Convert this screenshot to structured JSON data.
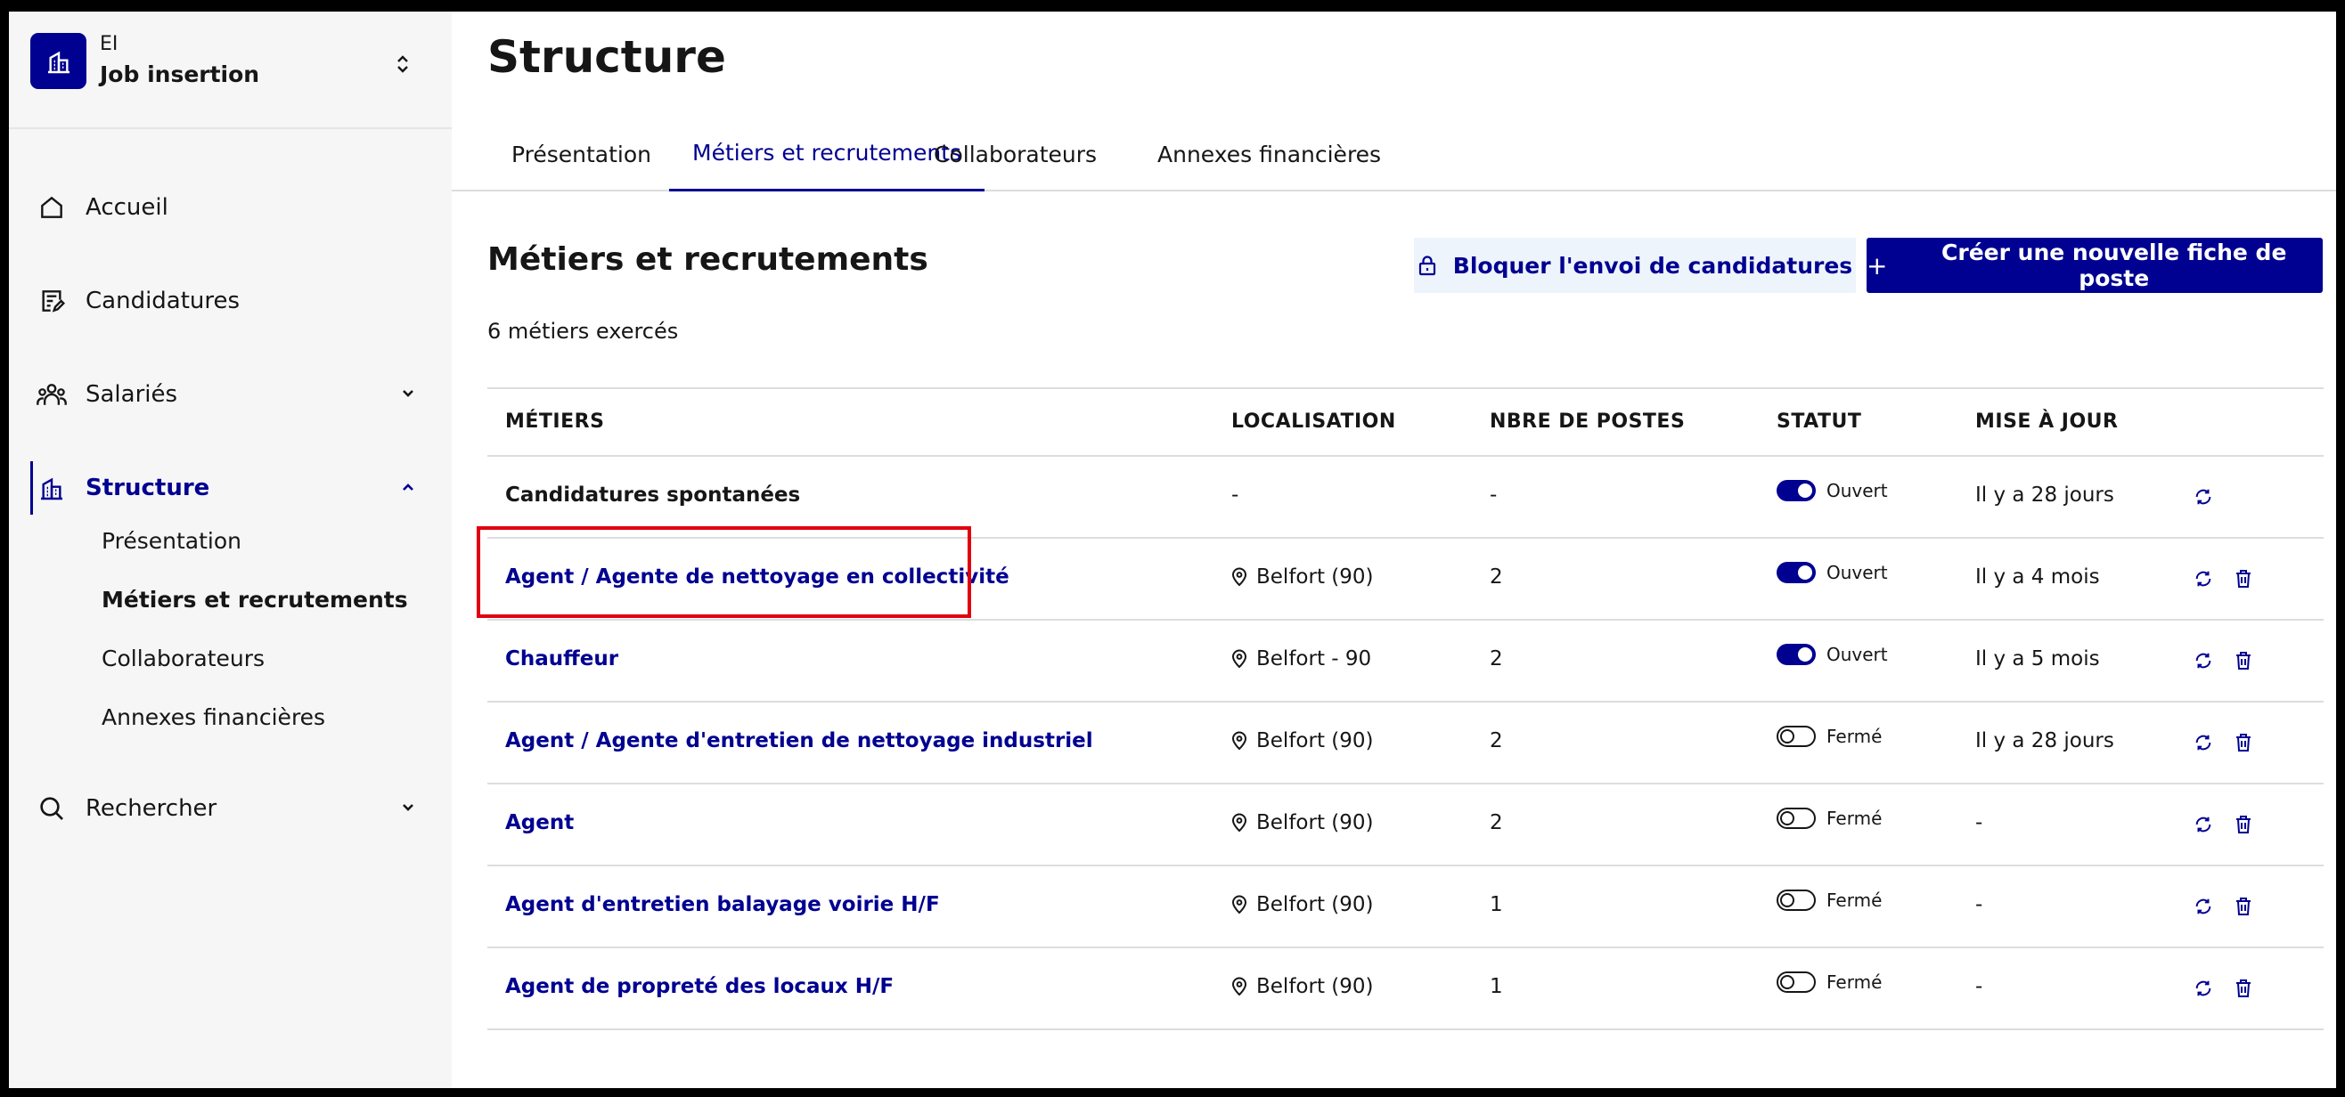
{
  "sidebar": {
    "org_type": "EI",
    "org_name": "Job insertion",
    "nav": [
      {
        "label": "Accueil",
        "icon": "home-icon"
      },
      {
        "label": "Candidatures",
        "icon": "edit-document-icon"
      },
      {
        "label": "Salariés",
        "icon": "team-icon"
      },
      {
        "label": "Structure",
        "icon": "building-icon"
      },
      {
        "label": "Rechercher",
        "icon": "search-icon"
      }
    ],
    "structure_sub": [
      "Présentation",
      "Métiers et recrutements",
      "Collaborateurs",
      "Annexes financières"
    ]
  },
  "main": {
    "page_title": "Structure",
    "tabs": [
      "Présentation",
      "Métiers et recrutements",
      "Collaborateurs",
      "Annexes financières"
    ],
    "section_title": "Métiers et recrutements",
    "count_text": "6 métiers exercés",
    "btn_block": "Bloquer l'envoi de candidatures",
    "btn_create": "Créer une nouvelle fiche de poste",
    "btn_create_plus": "+",
    "table": {
      "headers": [
        "MÉTIERS",
        "LOCALISATION",
        "NBRE DE POSTES",
        "STATUT",
        "MISE À JOUR"
      ],
      "rows": [
        {
          "metier": "Candidatures spontanées",
          "loc": "-",
          "postes": "-",
          "statut": "Ouvert",
          "maj": "Il y a 28 jours"
        },
        {
          "metier": "Agent / Agente de nettoyage en collectivité",
          "loc": "Belfort (90)",
          "postes": "2",
          "statut": "Ouvert",
          "maj": "Il y a 4 mois"
        },
        {
          "metier": "Chauffeur",
          "loc": "Belfort - 90",
          "postes": "2",
          "statut": "Ouvert",
          "maj": "Il y a 5 mois"
        },
        {
          "metier": "Agent / Agente d'entretien de nettoyage industriel",
          "loc": "Belfort (90)",
          "postes": "2",
          "statut": "Fermé",
          "maj": "Il y a 28 jours"
        },
        {
          "metier": "Agent",
          "loc": "Belfort (90)",
          "postes": "2",
          "statut": "Fermé",
          "maj": "-"
        },
        {
          "metier": "Agent d'entretien balayage voirie H/F",
          "loc": "Belfort (90)",
          "postes": "1",
          "statut": "Fermé",
          "maj": "-"
        },
        {
          "metier": "Agent de propreté des locaux H/F",
          "loc": "Belfort (90)",
          "postes": "1",
          "statut": "Fermé",
          "maj": "-"
        }
      ]
    }
  },
  "colors": {
    "primary": "#000091",
    "highlight": "#e1000f",
    "sidebar_bg": "#f6f6f6"
  }
}
